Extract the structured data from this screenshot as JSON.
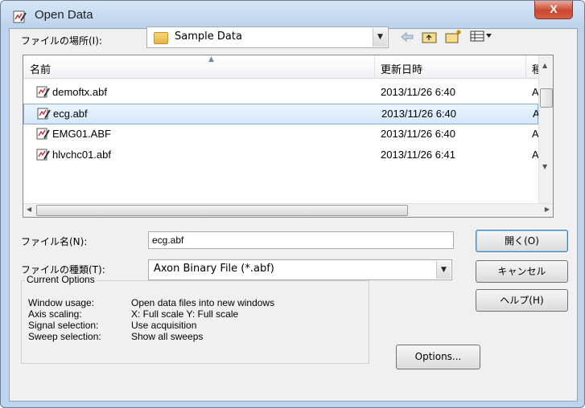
{
  "window": {
    "title": "Open Data",
    "close_label": "X"
  },
  "look_in": {
    "label": "ファイルの場所(I):",
    "value": "Sample Data"
  },
  "list": {
    "headers": {
      "name": "名前",
      "date": "更新日時",
      "type": "種"
    },
    "rows": [
      {
        "name": "demoftx.abf",
        "date": "2013/11/26 6:40",
        "type": "A"
      },
      {
        "name": "ecg.abf",
        "date": "2013/11/26 6:40",
        "type": "A"
      },
      {
        "name": "EMG01.ABF",
        "date": "2013/11/26 6:40",
        "type": "A"
      },
      {
        "name": "hlvchc01.abf",
        "date": "2013/11/26 6:41",
        "type": "A"
      }
    ]
  },
  "filename": {
    "label": "ファイル名(N):",
    "value": "ecg.abf"
  },
  "filetype": {
    "label": "ファイルの種類(T):",
    "value": "Axon Binary File (*.abf)"
  },
  "buttons": {
    "open": "開く(O)",
    "cancel": "キャンセル",
    "help": "ヘルプ(H)",
    "options": "Options..."
  },
  "options": {
    "legend": "Current Options",
    "rows": [
      {
        "key": "Window usage:",
        "val": "Open data files into new windows"
      },
      {
        "key": "Axis scaling:",
        "val": "X: Full scale    Y: Full scale"
      },
      {
        "key": "Signal selection:",
        "val": "Use acquisition"
      },
      {
        "key": "Sweep selection:",
        "val": "Show all sweeps"
      }
    ]
  }
}
